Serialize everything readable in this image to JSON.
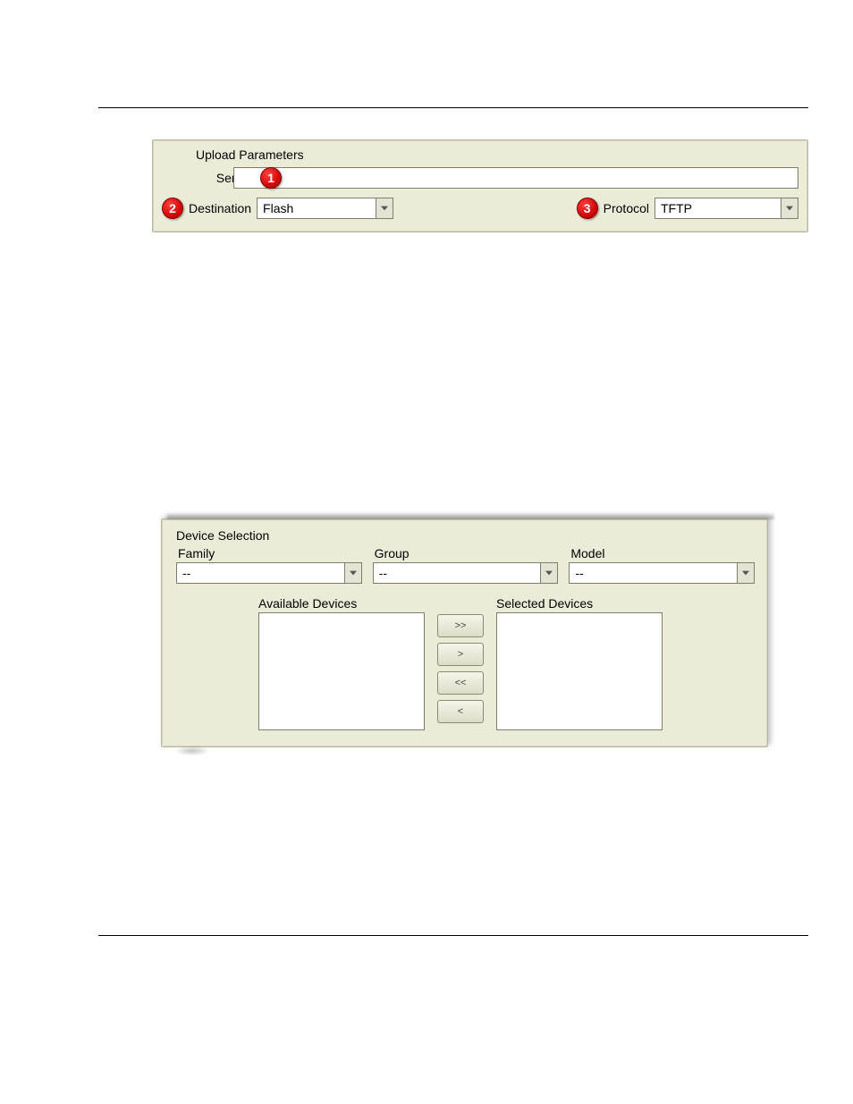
{
  "upload_parameters": {
    "title": "Upload Parameters",
    "server_label": "Server",
    "server_value": "",
    "destination_label": "Destination",
    "destination_value": "Flash",
    "protocol_label": "Protocol",
    "protocol_value": "TFTP",
    "callouts": {
      "one": "1",
      "two": "2",
      "three": "3"
    }
  },
  "device_selection": {
    "title": "Device Selection",
    "family_label": "Family",
    "family_value": "--",
    "group_label": "Group",
    "group_value": "--",
    "model_label": "Model",
    "model_value": "--",
    "available_label": "Available Devices",
    "selected_label": "Selected Devices",
    "buttons": {
      "all_right": ">>",
      "one_right": ">",
      "all_left": "<<",
      "one_left": "<"
    }
  }
}
